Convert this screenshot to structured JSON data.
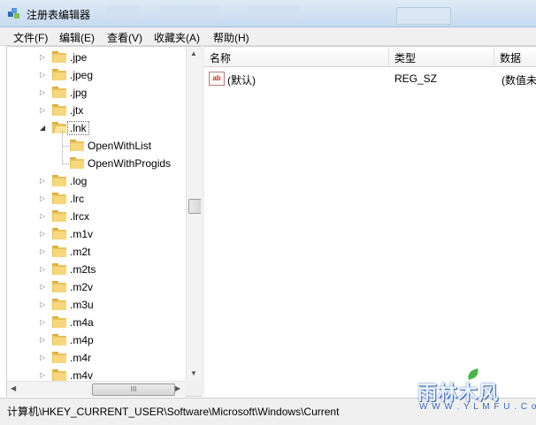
{
  "window": {
    "title": "注册表编辑器"
  },
  "menu": [
    {
      "label": "文件",
      "key": "(F)",
      "shortcut": "F"
    },
    {
      "label": "编辑",
      "key": "(E)",
      "shortcut": "E"
    },
    {
      "label": "查看",
      "key": "(V)",
      "shortcut": "V"
    },
    {
      "label": "收藏夹",
      "key": "(A)",
      "shortcut": "A"
    },
    {
      "label": "帮助",
      "key": "(H)",
      "shortcut": "H"
    }
  ],
  "tree": {
    "items": [
      {
        "label": ".jpe",
        "level": 0,
        "expander": "collapsed",
        "selected": false
      },
      {
        "label": ".jpeg",
        "level": 0,
        "expander": "collapsed",
        "selected": false
      },
      {
        "label": ".jpg",
        "level": 0,
        "expander": "collapsed",
        "selected": false
      },
      {
        "label": ".jtx",
        "level": 0,
        "expander": "collapsed",
        "selected": false
      },
      {
        "label": ".lnk",
        "level": 0,
        "expander": "expanded",
        "selected": true
      },
      {
        "label": "OpenWithList",
        "level": 1,
        "expander": "none",
        "selected": false
      },
      {
        "label": "OpenWithProgids",
        "level": 1,
        "expander": "none",
        "selected": false
      },
      {
        "label": ".log",
        "level": 0,
        "expander": "collapsed",
        "selected": false
      },
      {
        "label": ".lrc",
        "level": 0,
        "expander": "collapsed",
        "selected": false
      },
      {
        "label": ".lrcx",
        "level": 0,
        "expander": "collapsed",
        "selected": false
      },
      {
        "label": ".m1v",
        "level": 0,
        "expander": "collapsed",
        "selected": false
      },
      {
        "label": ".m2t",
        "level": 0,
        "expander": "collapsed",
        "selected": false
      },
      {
        "label": ".m2ts",
        "level": 0,
        "expander": "collapsed",
        "selected": false
      },
      {
        "label": ".m2v",
        "level": 0,
        "expander": "collapsed",
        "selected": false
      },
      {
        "label": ".m3u",
        "level": 0,
        "expander": "collapsed",
        "selected": false
      },
      {
        "label": ".m4a",
        "level": 0,
        "expander": "collapsed",
        "selected": false
      },
      {
        "label": ".m4p",
        "level": 0,
        "expander": "collapsed",
        "selected": false
      },
      {
        "label": ".m4r",
        "level": 0,
        "expander": "collapsed",
        "selected": false
      },
      {
        "label": ".m4v",
        "level": 0,
        "expander": "collapsed",
        "selected": false
      }
    ],
    "hscroll_grip": "III"
  },
  "list": {
    "columns": [
      "名称",
      "类型",
      "数据"
    ],
    "rows": [
      {
        "icon": "string-value-icon",
        "icon_text": "ab",
        "name": "(默认)",
        "type": "REG_SZ",
        "data": "(数值未"
      }
    ]
  },
  "status": {
    "path": "计算机\\HKEY_CURRENT_USER\\Software\\Microsoft\\Windows\\Current"
  },
  "watermark": {
    "main": "雨林木风",
    "sub": "W W W . Y L M F U . C o M"
  },
  "colors": {
    "folder": "#f6d77e",
    "titlebar": "#c7daf0",
    "watermark": "#3a6bb5"
  }
}
